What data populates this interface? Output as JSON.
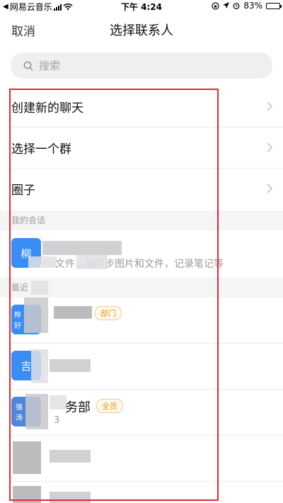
{
  "status": {
    "carrier": "网易云音乐",
    "time": "下午 4:24",
    "battery": "83%",
    "battery_level": 0.83
  },
  "nav": {
    "cancel_label": "取消",
    "title": "选择联系人"
  },
  "search": {
    "placeholder": "搜索"
  },
  "menu": [
    {
      "label": "创建新的聊天"
    },
    {
      "label": "选择一个群"
    },
    {
      "label": "圈子"
    }
  ],
  "sections": {
    "my_chats": "我的会话",
    "recent": "最近"
  },
  "my_chat": {
    "avatar_text": "柳",
    "subtitle": "文件…端同步图片和文件，记录笔记等"
  },
  "recent": [
    {
      "avatar_text": [
        "桦",
        "好"
      ],
      "tag": "部门"
    },
    {
      "avatar_text": [
        "吉"
      ],
      "tag": ""
    },
    {
      "avatar_text": [
        "强",
        "涛"
      ],
      "name": "务部",
      "tag": "全员",
      "count": "3"
    },
    {
      "avatar_text": [],
      "tag": ""
    },
    {
      "avatar_text": [],
      "tag": ""
    }
  ],
  "colors": {
    "accent": "#3b8df6",
    "highlight_box": "#e02b2b",
    "tag": "#e59a1a"
  }
}
